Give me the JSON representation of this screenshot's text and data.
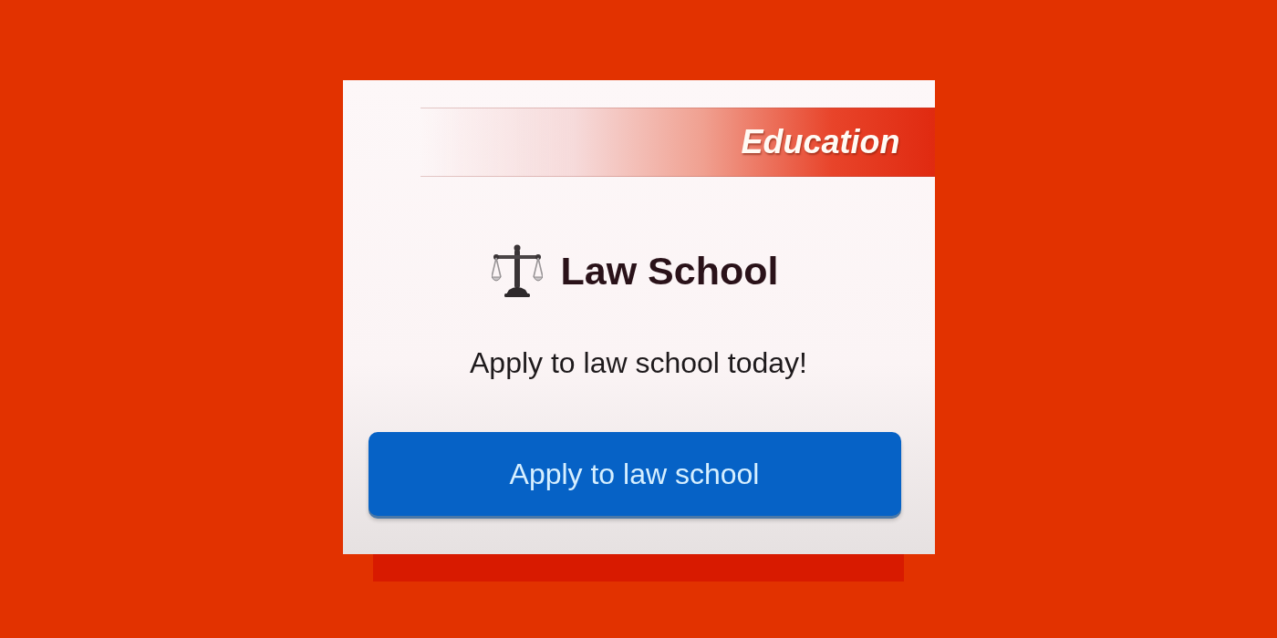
{
  "card": {
    "category": "Education",
    "title": "Law School",
    "description": "Apply to law school today!",
    "button": "Apply to law school"
  }
}
